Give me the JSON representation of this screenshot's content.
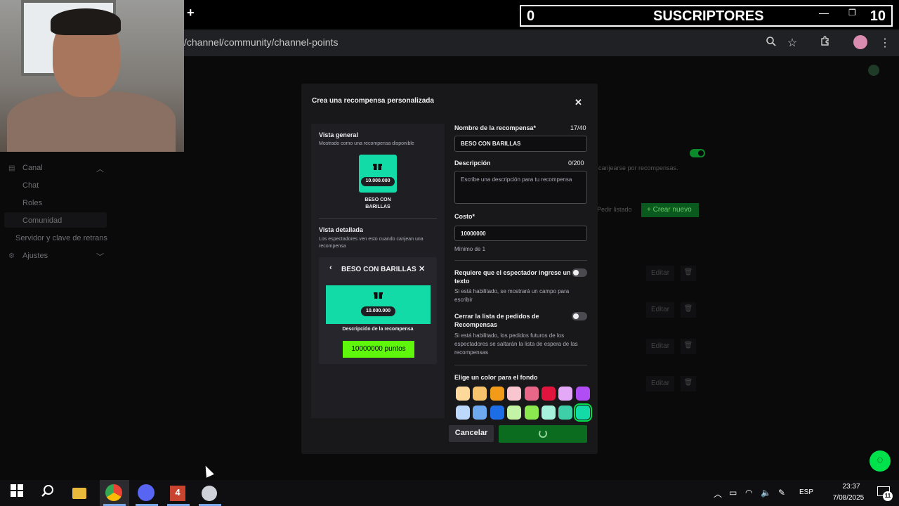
{
  "browser": {
    "new_tab_icon": "plus-icon",
    "url": "/channel/community/channel-points",
    "tool_icons": [
      "zoom-icon",
      "star-icon",
      "extensions-icon",
      "profile-avatar",
      "menu-icon"
    ]
  },
  "overlay": {
    "subs_count": "0",
    "subs_label": "SUSCRIPTORES",
    "subs_goal": "10"
  },
  "sidebar": {
    "canal": "Canal",
    "chat": "Chat",
    "roles": "Roles",
    "comunidad": "Comunidad",
    "servidor": "Servidor y clave de retrans",
    "ajustes": "Ajustes"
  },
  "background": {
    "desc_fragment": "canjearse por recompensas.",
    "pedir_listado": "Pedir listado",
    "crear_nuevo": "Crear nuevo",
    "edit_label": "Editar"
  },
  "modal": {
    "title": "Crea una recompensa personalizada",
    "preview": {
      "general_title": "Vista general",
      "general_sub": "Mostrado como una recompensa disponible",
      "cost_badge": "10.000.000",
      "reward_name_line1": "BESO CON",
      "reward_name_line2": "BARILLAS",
      "detail_title": "Vista detallada",
      "detail_sub": "Los espectadores ven esto cuando canjean una recompensa",
      "detail_name": "BESO CON BARILLAS",
      "detail_desc": "Descripción de la recompensa",
      "detail_button": "10000000 puntos"
    },
    "form": {
      "name_label": "Nombre de la recompensa*",
      "name_counter": "17/40",
      "name_value": "BESO CON BARILLAS",
      "desc_label": "Descripción",
      "desc_counter": "0/200",
      "desc_placeholder": "Escribe una descripción para tu recompensa",
      "cost_label": "Costo*",
      "cost_value": "10000000",
      "cost_min": "Mínimo de 1",
      "require_text_label": "Requiere que el espectador ingrese un texto",
      "require_text_hint": "Si está habilitado, se mostrará un campo para escribir",
      "require_text_enabled": false,
      "skip_queue_label": "Cerrar la lista de pedidos de Recompensas",
      "skip_queue_hint": "Si está habilitado, los pedidos futuros de los espectadores se saltarán la lista de espera de las recompensas",
      "skip_queue_enabled": false,
      "color_label": "Elige un color para el fondo",
      "colors": [
        "#fcd99b",
        "#f6c26b",
        "#f29b18",
        "#f9c6d0",
        "#e86788",
        "#e0143c",
        "#e3a9f7",
        "#b04df5",
        "#bcd9fb",
        "#6ea8ee",
        "#1d6ee6",
        "#c3f3a5",
        "#8ce84f",
        "#a5f1dc",
        "#3ecfa8",
        "#13dba8"
      ],
      "selected_color": "#13dba8"
    },
    "cancel_label": "Cancelar"
  },
  "taskbar": {
    "lang": "ESP",
    "time": "23:37",
    "date": "7/08/2025",
    "notif_count": "11",
    "app4_label": "4"
  }
}
